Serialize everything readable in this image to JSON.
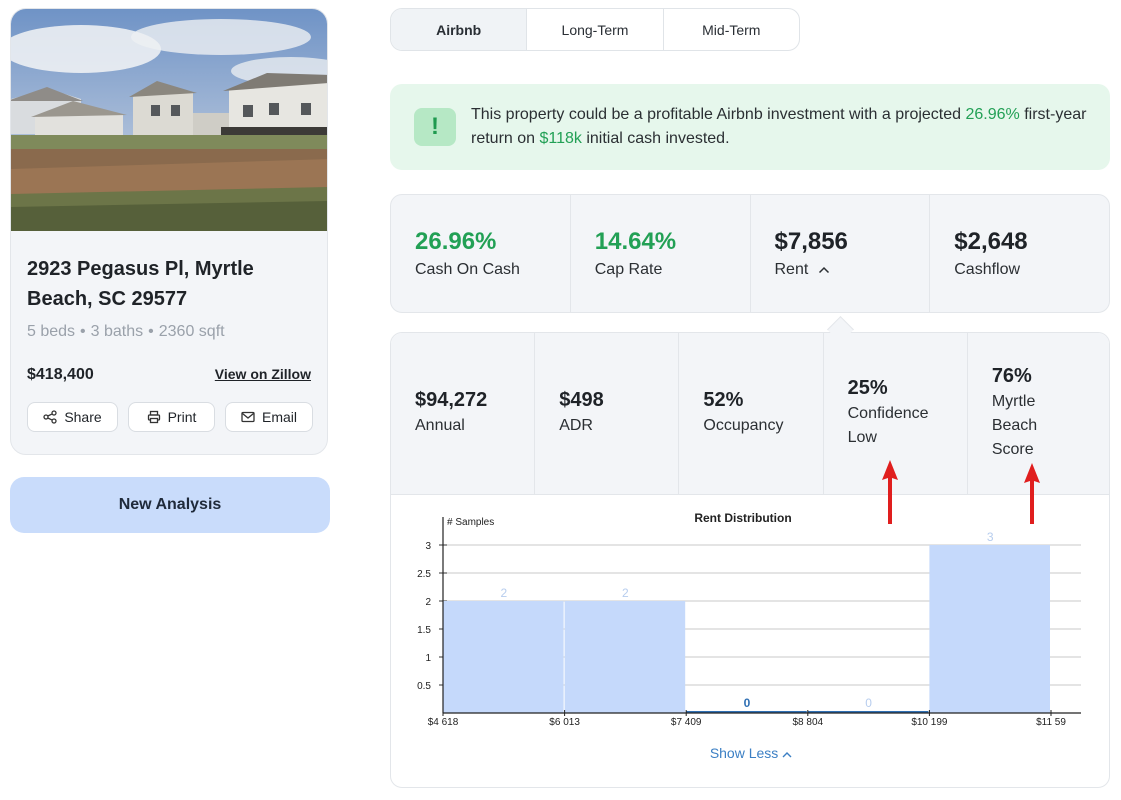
{
  "property": {
    "photo_alt": "Street view of house",
    "address": "2923 Pegasus Pl, Myrtle Beach, SC 29577",
    "specs": [
      "5 beds",
      "3 baths",
      "2360 sqft"
    ],
    "price": "$418,400",
    "zillow_link": "View on Zillow",
    "actions": [
      {
        "label": "Share",
        "icon": "share-icon"
      },
      {
        "label": "Print",
        "icon": "printer-icon"
      },
      {
        "label": "Email",
        "icon": "mail-icon"
      }
    ]
  },
  "new_analysis_label": "New Analysis",
  "tabs": [
    {
      "label": "Airbnb",
      "active": true
    },
    {
      "label": "Long-Term",
      "active": false
    },
    {
      "label": "Mid-Term",
      "active": false
    }
  ],
  "alert": {
    "icon": "!",
    "text_before": "This property could be a profitable Airbnb investment with a projected ",
    "return_pct": "26.96%",
    "text_middle": " first-year return on ",
    "cash": "$118k",
    "text_after": " initial cash invested."
  },
  "metrics": [
    {
      "value": "26.96%",
      "label": "Cash On Cash",
      "green": true
    },
    {
      "value": "14.64%",
      "label": "Cap Rate",
      "green": true
    },
    {
      "value": "$7,856",
      "label": "Rent",
      "green": false,
      "chevron": "up"
    },
    {
      "value": "$2,648",
      "label": "Cashflow",
      "green": false
    }
  ],
  "stats": [
    {
      "value": "$94,272",
      "label": [
        "Annual"
      ]
    },
    {
      "value": "$498",
      "label": [
        "ADR"
      ]
    },
    {
      "value": "52%",
      "label": [
        "Occupancy"
      ]
    },
    {
      "value": "25%",
      "label": [
        "Confidence",
        "Low"
      ]
    },
    {
      "value": "76%",
      "label": [
        "Myrtle",
        "Beach",
        "Score"
      ]
    }
  ],
  "chart_data": {
    "type": "bar",
    "title": "Rent Distribution",
    "ylabel": "# Samples",
    "xlabel": "",
    "bin_edges": [
      "$4 618",
      "$6 013",
      "$7 409",
      "$8 804",
      "$10 199",
      "$11 59"
    ],
    "values": [
      2,
      2,
      0,
      0,
      3
    ],
    "data_labels": [
      "2",
      "2",
      "0",
      "0",
      "3"
    ],
    "ylim": [
      0,
      3
    ],
    "yticks": [
      "0.5",
      "1",
      "1.5",
      "2",
      "2.5",
      "3"
    ],
    "grid": true,
    "bar_color": "#c5d9fb"
  },
  "show_less_label": "Show Less",
  "annotation_color": "#e01e1e"
}
